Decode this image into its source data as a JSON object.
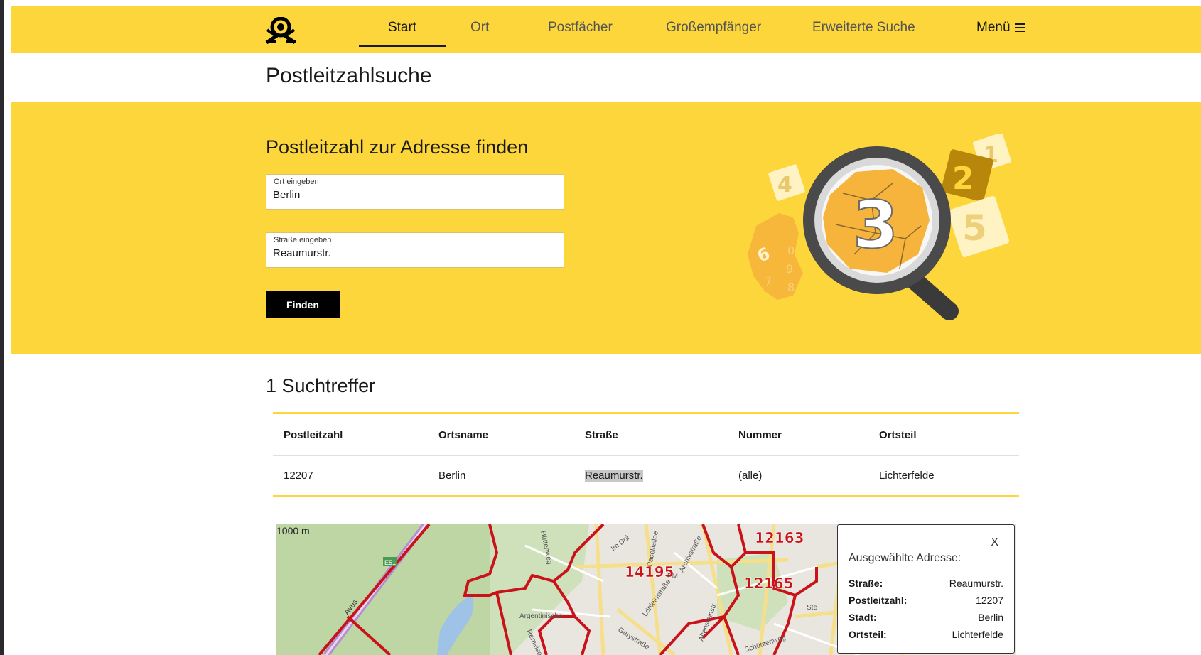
{
  "nav": {
    "items": [
      "Start",
      "Ort",
      "Postfächer",
      "Großempfänger",
      "Erweiterte Suche"
    ],
    "active": "Start",
    "menu_label": "Menü",
    "brand_color": "#fdd63b"
  },
  "page_title": "Postleitzahlsuche",
  "search": {
    "heading": "Postleitzahl zur Adresse finden",
    "ort_label": "Ort eingeben",
    "ort_value": "Berlin",
    "strasse_label": "Straße eingeben",
    "strasse_value": "Reaumurstr.",
    "button_label": "Finden",
    "illustration": {
      "digits": [
        "4",
        "3",
        "2",
        "1",
        "5",
        "6",
        "0",
        "9",
        "8",
        "7"
      ]
    }
  },
  "results": {
    "title": "1 Suchtreffer",
    "columns": [
      "Postleitzahl",
      "Ortsname",
      "Straße",
      "Nummer",
      "Ortsteil"
    ],
    "rows": [
      [
        "12207",
        "Berlin",
        "Reaumurstr.",
        "(alle)",
        "Lichterfelde"
      ]
    ]
  },
  "map": {
    "scale": "1000 m",
    "zip_labels": [
      "14195",
      "12163",
      "12165"
    ],
    "road_labels": [
      "E51",
      "Avus",
      "Hüttenweg",
      "Im Dol",
      "Pacelliallee",
      "Archivstraße",
      "Argentinische",
      "Garystraße",
      "Löhleinstraße",
      "Altensteinstr.",
      "Schützenweg",
      "Ste",
      "Remeisestr.",
      "EM"
    ],
    "popup": {
      "close": "X",
      "title": "Ausgewählte Adresse:",
      "fields": [
        {
          "label": "Straße:",
          "value": "Reaumurstr."
        },
        {
          "label": "Postleitzahl:",
          "value": "12207"
        },
        {
          "label": "Stadt:",
          "value": "Berlin"
        },
        {
          "label": "Ortsteil:",
          "value": "Lichterfelde"
        }
      ]
    }
  }
}
